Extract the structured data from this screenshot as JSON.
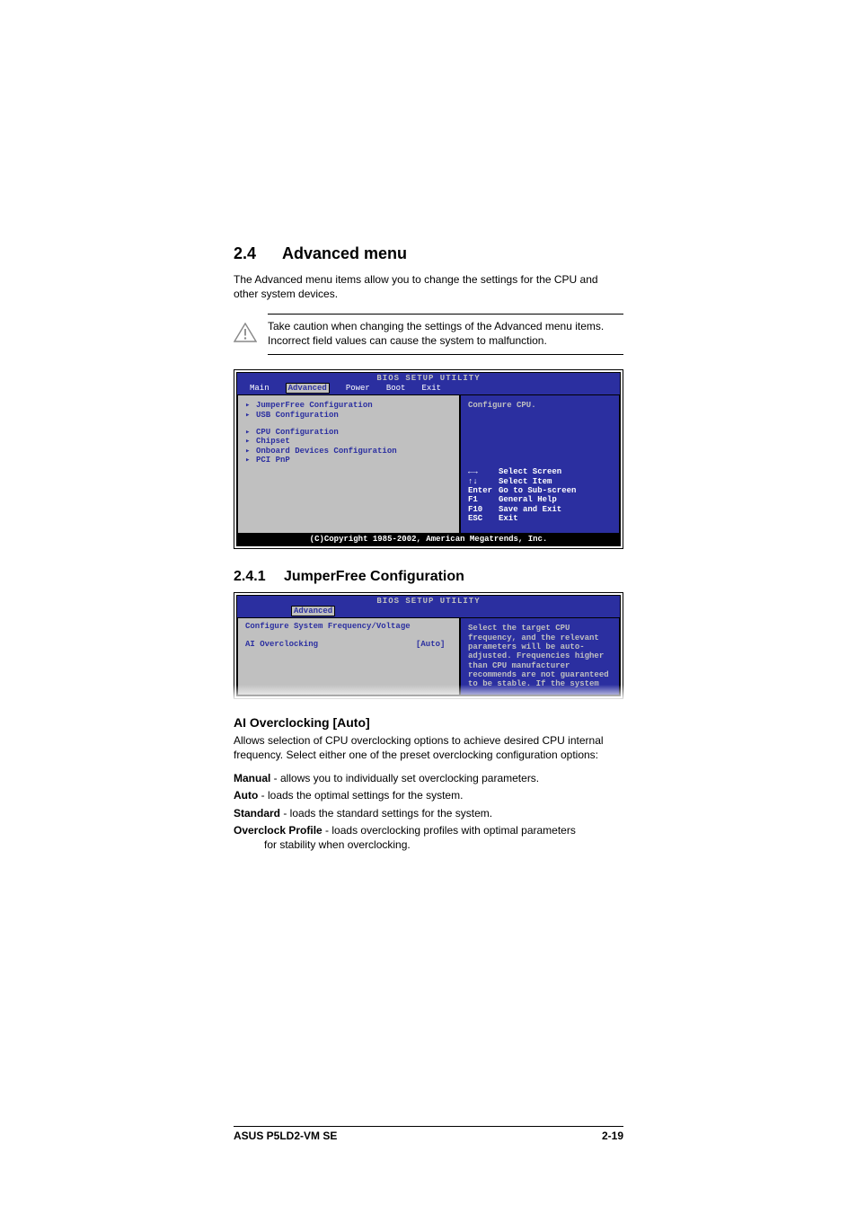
{
  "section": {
    "number": "2.4",
    "title": "Advanced menu",
    "intro": "The Advanced menu items allow you to change the settings for the CPU and other system devices.",
    "callout": "Take caution when changing the settings of the Advanced menu items. Incorrect field values can cause the system to malfunction."
  },
  "bios1": {
    "title": "BIOS SETUP UTILITY",
    "tabs": {
      "main": "Main",
      "advanced": "Advanced",
      "power": "Power",
      "boot": "Boot",
      "exit": "Exit"
    },
    "items": {
      "jumperfree": "JumperFree Configuration",
      "usb": "USB Configuration",
      "cpu": "CPU Configuration",
      "chipset": "Chipset",
      "onboard": "Onboard Devices Configuration",
      "pcipnp": "PCI PnP"
    },
    "help": "Configure CPU.",
    "nav": {
      "screen": "Select Screen",
      "item": "Select Item",
      "enter_key": "Enter",
      "enter": "Go to Sub-screen",
      "f1_key": "F1",
      "f1": "General Help",
      "f10_key": "F10",
      "f10": "Save and Exit",
      "esc_key": "ESC",
      "esc": "Exit"
    },
    "footer": "(C)Copyright 1985-2002, American Megatrends, Inc."
  },
  "subsection": {
    "number": "2.4.1",
    "title": "JumperFree Configuration"
  },
  "bios2": {
    "title": "BIOS SETUP UTILITY",
    "tab": "Advanced",
    "heading": "Configure System Frequency/Voltage",
    "field_label": "AI Overclocking",
    "field_value": "[Auto]",
    "help": "Select the target CPU frequency, and the relevant parameters will be auto-adjusted. Frequencies higher than CPU manufacturer recommends are not guaranteed to be stable. If the system"
  },
  "ai": {
    "heading": "AI Overclocking [Auto]",
    "body": "Allows selection of CPU overclocking options to achieve desired CPU internal frequency. Select either one of the preset overclocking configuration options:",
    "options": {
      "manual_t": "Manual",
      "manual_d": " - allows you to individually set overclocking parameters.",
      "auto_t": "Auto",
      "auto_d": " - loads the optimal settings for the system.",
      "standard_t": "Standard",
      "standard_d": " - loads the standard settings for the system.",
      "overclock_t": "Overclock Profile",
      "overclock_d": " - loads overclocking profiles with optimal parameters",
      "overclock_cont": "for stability when overclocking."
    }
  },
  "footer": {
    "left": "ASUS P5LD2-VM SE",
    "right": "2-19"
  }
}
